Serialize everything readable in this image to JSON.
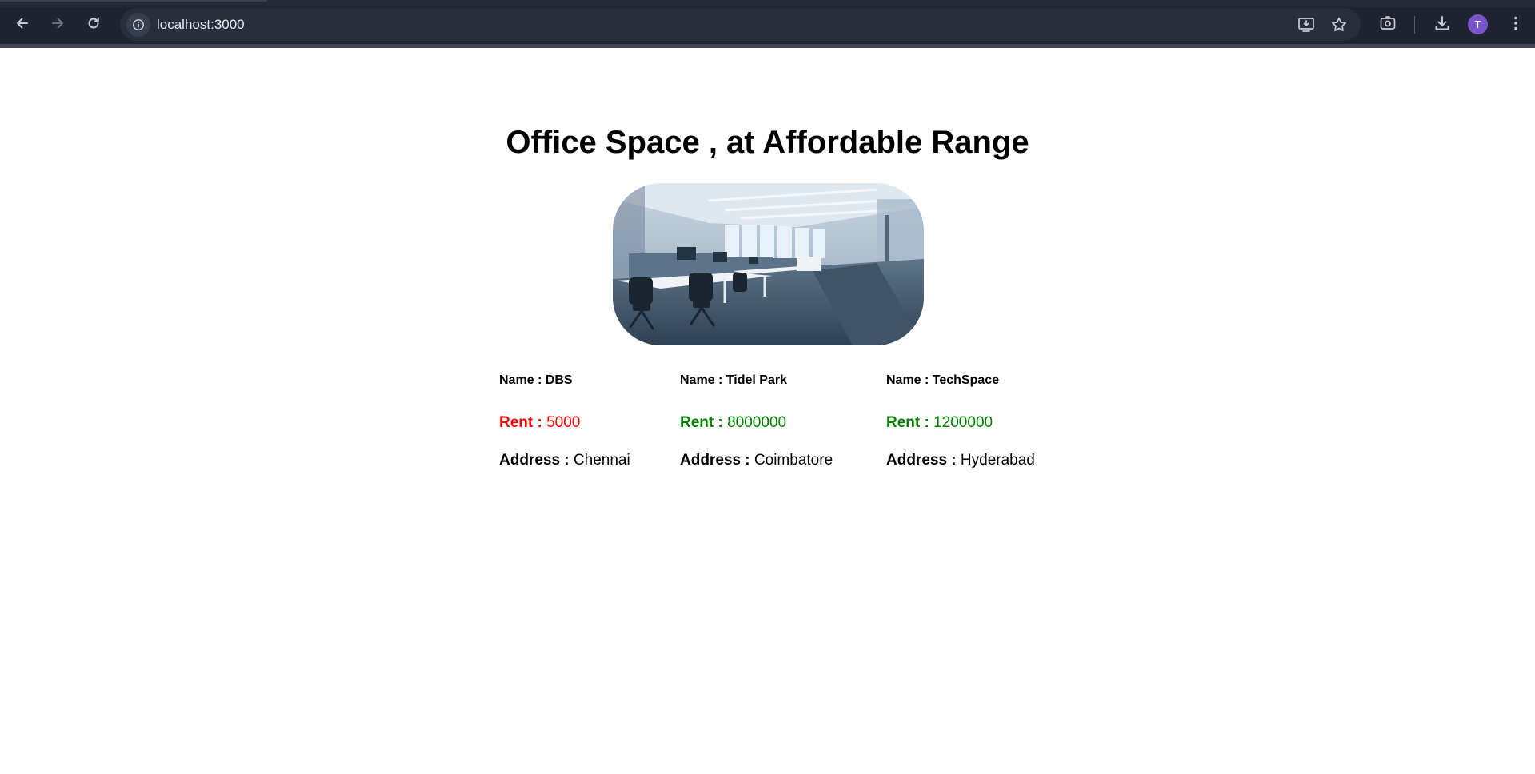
{
  "browser": {
    "url": "localhost:3000",
    "profile_initial": "T",
    "icons": [
      "back-icon",
      "forward-icon",
      "reload-icon",
      "site-info-icon",
      "install-app-icon",
      "bookmark-star-icon",
      "screenshot-lens-icon",
      "download-icon",
      "more-menu-icon"
    ]
  },
  "page": {
    "title": "Office Space , at Affordable Range",
    "image_alt": "office interior",
    "cards": [
      {
        "name_label": "Name : DBS",
        "rent_label": "Rent :",
        "rent_value": "5000",
        "rent_color": "#ff0000",
        "address_label": "Address :",
        "address_value": "Chennai"
      },
      {
        "name_label": "Name : Tidel Park",
        "rent_label": "Rent :",
        "rent_value": "8000000",
        "rent_color": "#008000",
        "address_label": "Address :",
        "address_value": "Coimbatore"
      },
      {
        "name_label": "Name : TechSpace",
        "rent_label": "Rent :",
        "rent_value": "1200000",
        "rent_color": "#008000",
        "address_label": "Address :",
        "address_value": "Hyderabad"
      }
    ]
  }
}
